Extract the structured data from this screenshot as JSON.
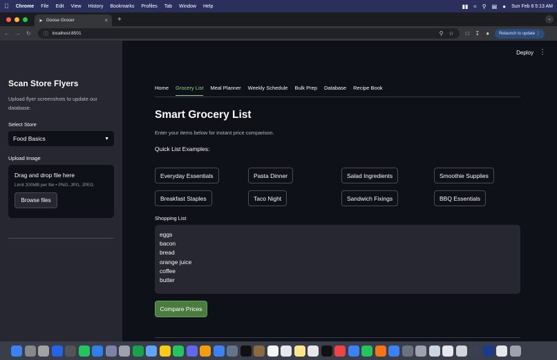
{
  "menubar": {
    "app": "Chrome",
    "items": [
      "File",
      "Edit",
      "View",
      "History",
      "Bookmarks",
      "Profiles",
      "Tab",
      "Window",
      "Help"
    ],
    "clock": "Sun Feb 8  5:13 AM"
  },
  "browser": {
    "tab_title": "Goose Grocer",
    "url": "localhost:8501",
    "relaunch_label": "Relaunch to update"
  },
  "sidebar": {
    "title": "Scan Store Flyers",
    "description": "Upload flyer screenshots to update our database.",
    "store_label": "Select Store",
    "store_value": "Food Basics",
    "upload_label": "Upload Image",
    "dropzone_title": "Drag and drop file here",
    "dropzone_limit": "Limit 200MB per file • PNG, JPG, JPEG",
    "browse_label": "Browse files"
  },
  "header": {
    "deploy_label": "Deploy"
  },
  "tabs": [
    "Home",
    "Grocery List",
    "Meal Planner",
    "Weekly Schedule",
    "Bulk Prep",
    "Database",
    "Recipe Book"
  ],
  "main": {
    "title": "Smart Grocery List",
    "subtitle": "Enter your items below for instant price comparison.",
    "quick_label": "Quick List Examples:",
    "quick_buttons": [
      "Everyday Essentials",
      "Pasta Dinner",
      "Salad Ingredients",
      "Smoothie Supplies",
      "Breakfast Staples",
      "Taco Night",
      "Sandwich Fixings",
      "BBQ Essentials"
    ],
    "shopping_label": "Shopping List",
    "shopping_items": [
      "eggs",
      "bacon",
      "bread",
      "orange juice",
      "coffee",
      "butter"
    ],
    "compare_label": "Compare Prices"
  },
  "colors": {
    "accent": "#8fd48a",
    "button_green": "#4a7c3f",
    "sidebar_bg": "#262730",
    "main_bg": "#0e1117"
  }
}
